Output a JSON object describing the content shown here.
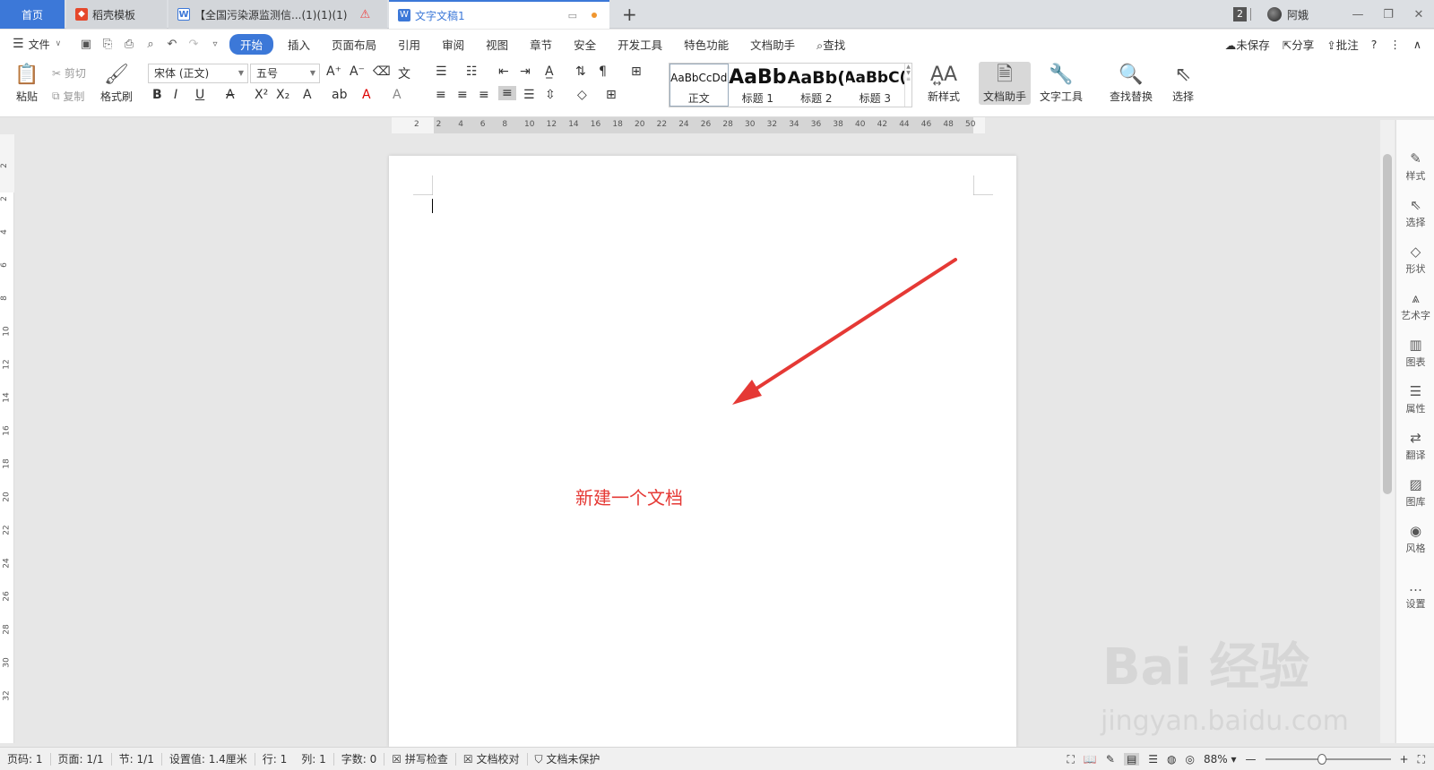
{
  "tabs": {
    "home": "首页",
    "daoke": "稻壳模板",
    "doc1": "【全国污染源监测信...(1)(1)(1)",
    "doc2": "文字文稿1"
  },
  "window": {
    "badge": "2",
    "user": "阿娥"
  },
  "menu": {
    "file": "文件",
    "items": [
      "开始",
      "插入",
      "页面布局",
      "引用",
      "审阅",
      "视图",
      "章节",
      "安全",
      "开发工具",
      "特色功能",
      "文档助手"
    ],
    "search": "查找",
    "unsaved": "未保存",
    "share": "分享",
    "comment": "批注"
  },
  "ribbon": {
    "paste": "粘贴",
    "cut": "剪切",
    "copy": "复制",
    "format_painter": "格式刷",
    "font_name": "宋体 (正文)",
    "font_size": "五号",
    "styles": [
      {
        "sample": "AaBbCcDd",
        "label": "正文"
      },
      {
        "sample": "AaBb",
        "label": "标题 1"
      },
      {
        "sample": "AaBb(",
        "label": "标题 2"
      },
      {
        "sample": "AaBbC(",
        "label": "标题 3"
      }
    ],
    "new_style": "新样式",
    "doc_assistant": "文档助手",
    "text_tools": "文字工具",
    "find_replace": "查找替换",
    "select": "选择"
  },
  "ruler": {
    "h_ticks": [
      "2",
      "2",
      "4",
      "6",
      "8",
      "10",
      "12",
      "14",
      "16",
      "18",
      "20",
      "22",
      "24",
      "26",
      "28",
      "30",
      "32",
      "34",
      "36",
      "38",
      "40",
      "42",
      "44",
      "46",
      "48",
      "50"
    ],
    "v_ticks": [
      "2",
      "2",
      "4",
      "6",
      "8",
      "10",
      "12",
      "14",
      "16",
      "18",
      "20",
      "22",
      "24",
      "26",
      "28",
      "30",
      "32"
    ]
  },
  "document": {
    "annotation": "新建一个文档",
    "arrow_color": "#e53935"
  },
  "sidebar": {
    "items": [
      "样式",
      "选择",
      "形状",
      "艺术字",
      "图表",
      "属性",
      "翻译",
      "图库",
      "风格",
      "设置"
    ]
  },
  "status": {
    "page": "页码: 1",
    "pages": "页面: 1/1",
    "section": "节: 1/1",
    "setting": "设置值: 1.4厘米",
    "row": "行: 1",
    "col": "列: 1",
    "words": "字数: 0",
    "spell": "拼写检查",
    "proof": "文档校对",
    "protect": "文档未保护",
    "zoom": "88%",
    "zoom_level": 0.45
  },
  "watermark": {
    "brand": "Bai 经验",
    "url": "jingyan.baidu.com"
  }
}
